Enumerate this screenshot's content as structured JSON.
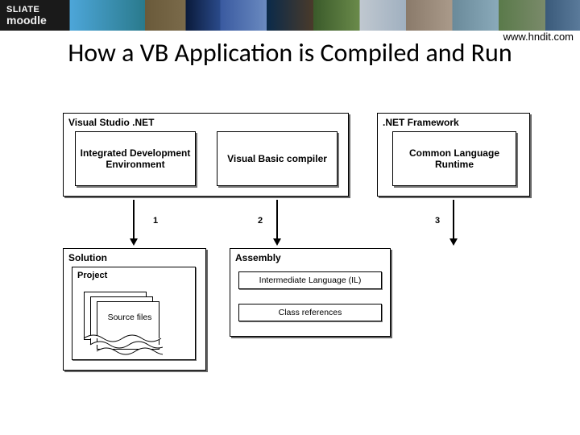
{
  "site_url": "www.hndit.com",
  "logo": {
    "line1": "SLIATE",
    "line2": "moodle"
  },
  "title": "How a VB Application is Compiled and Run",
  "vs": {
    "label": "Visual Studio .NET",
    "ide": "Integrated Development Environment",
    "compiler": "Visual Basic compiler"
  },
  "fw": {
    "label": ".NET Framework",
    "clr": "Common Language Runtime"
  },
  "steps": {
    "s1": "1",
    "s2": "2",
    "s3": "3"
  },
  "solution": {
    "label": "Solution",
    "project": "Project",
    "source": "Source files"
  },
  "assembly": {
    "label": "Assembly",
    "il": "Intermediate Language (IL)",
    "refs": "Class references"
  }
}
